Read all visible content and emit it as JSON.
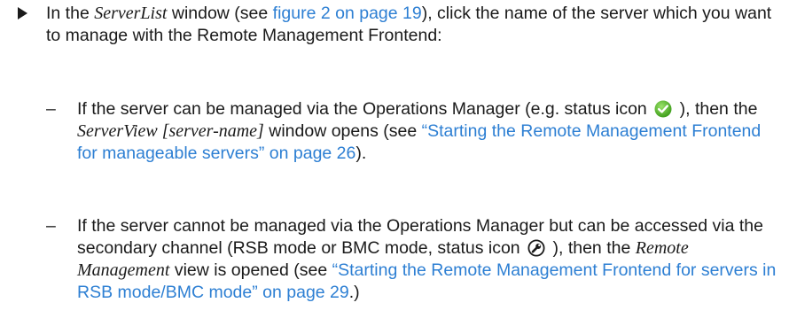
{
  "step": {
    "part1": "In the ",
    "window_name": "ServerList",
    "part2": " window (see ",
    "fig_link": "figure 2 on page 19",
    "part3": "), click the name of the server which you want to manage with the Remote Management Frontend:"
  },
  "sub_items": [
    {
      "dash": "–",
      "part1": "If the server can be managed via the Operations Manager (e.g. status icon ",
      "icon": "green-check-status-icon",
      "part2": " ), then the ",
      "ital": "ServerView [server-name]",
      "part3": " window opens (see ",
      "link": "“Starting the Remote Management Frontend for manageable servers” on page 26",
      "part4": ")."
    },
    {
      "dash": "–",
      "part1": "If the server cannot be managed via the Operations Manager but can be accessed via the secondary channel (RSB mode or BMC mode, status icon ",
      "icon": "wrench-status-icon",
      "part2": " ), then the ",
      "ital": "Remote Management",
      "part3": " view is opened (see ",
      "link": "“Starting the Remote Management Frontend for servers in RSB mode/BMC mode” on page 29",
      "part4": ".)"
    }
  ],
  "colors": {
    "link": "#2d7fd3",
    "check_green": "#5cc02e"
  }
}
